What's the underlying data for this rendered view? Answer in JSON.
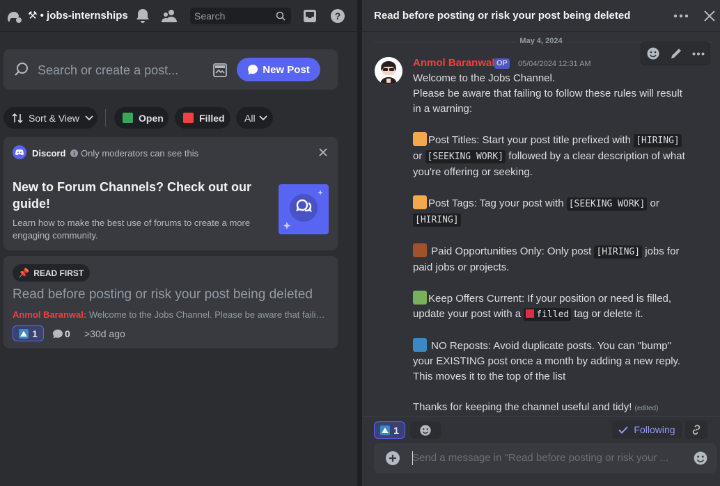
{
  "left": {
    "server_icon": "discord-blob-icon",
    "channel_name": "⚒ • jobs-internships",
    "header_icons": [
      "bell-icon",
      "members-icon",
      "inbox-icon",
      "help-icon"
    ],
    "search_placeholder": "Search",
    "forum_search_placeholder": "Search or create a post...",
    "new_post_label": "New Post",
    "filters": {
      "sort_label": "Sort & View",
      "open_label": "Open",
      "filled_label": "Filled",
      "all_label": "All",
      "open_color": "#3ba55c",
      "filled_color": "#ed4245"
    },
    "guide": {
      "app_name": "Discord",
      "notice": "Only moderators can see this",
      "title": "New to Forum Channels? Check out our guide!",
      "description": "Learn how to make the best use of forums to create a more engaging community."
    },
    "post": {
      "tag": "READ FIRST",
      "title": "Read before posting or risk your post being deleted",
      "author": "Anmol Baranwal",
      "preview": "Welcome to the Jobs Channel. Please be aware that failing to follow these rules will result in a warning",
      "reaction_count": "1",
      "message_count": "0",
      "age": ">30d ago"
    }
  },
  "right": {
    "thread_title": "Read before posting or risk your post being deleted",
    "date_separator": "May 4, 2024",
    "message": {
      "author": "Anmol Baranwal",
      "badge": "OP",
      "timestamp": "05/04/2024 12:31 AM",
      "intro1": "Welcome to the Jobs Channel.",
      "intro2": "Please be aware that failing to follow these rules will result in a warning:",
      "rule1_a": "Post Titles: Start your post title prefixed with ",
      "rule1_code1": "[HIRING]",
      "rule1_b": " or ",
      "rule1_code2": "[SEEKING WORK]",
      "rule1_c": " followed by a clear description of what you're offering or seeking.",
      "rule2_a": "Post Tags: Tag your post with ",
      "rule2_code1": "[SEEKING WORK]",
      "rule2_b": " or ",
      "rule2_code2": "[HIRING]",
      "rule3_a": " Paid Opportunities Only: Only post ",
      "rule3_code": "[HIRING]",
      "rule3_b": " jobs for paid jobs or projects.",
      "rule4_a": "Keep Offers Current: If your position or need is filled, update your post with a ",
      "rule4_code": "filled",
      "rule4_b": " tag or delete it.",
      "rule5": " NO Reposts: Avoid duplicate posts. You can \"bump\" your EXISTING post once a month by adding a new reply. This moves it to the top of the list",
      "outro": "Thanks for keeping the channel useful and tidy!",
      "edited": "(edited)"
    },
    "reaction_count": "1",
    "following_label": "Following",
    "composer_placeholder": "Send a message in \"Read before posting or risk your ..."
  },
  "colors": {
    "accent": "#5865f2",
    "author": "#f23f43"
  }
}
